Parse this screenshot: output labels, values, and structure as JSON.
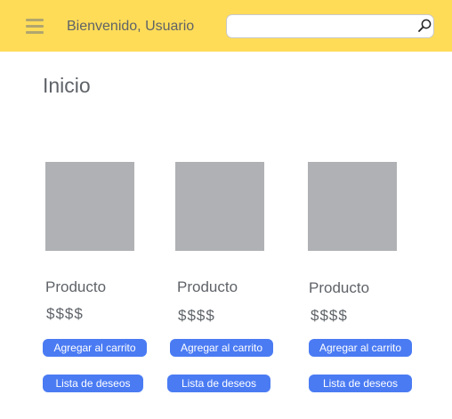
{
  "header": {
    "welcome_text": "Bienvenido, Usuario",
    "search": {
      "value": "",
      "placeholder": ""
    },
    "icons": {
      "menu": "hamburger-menu-icon",
      "search": "magnifier-icon"
    },
    "background_color": "#ffdc58"
  },
  "page": {
    "title": "Inicio"
  },
  "products": [
    {
      "name": "Producto",
      "price": "$$$$",
      "add_to_cart_label": "Agregar al carrito",
      "wishlist_label": "Lista de deseos"
    },
    {
      "name": "Producto",
      "price": "$$$$",
      "add_to_cart_label": "Agregar al carrito",
      "wishlist_label": "Lista de deseos"
    },
    {
      "name": "Producto",
      "price": "$$$$",
      "add_to_cart_label": "Agregar al carrito",
      "wishlist_label": "Lista de deseos"
    }
  ],
  "colors": {
    "accent_button": "#4a7bf3",
    "image_placeholder": "#b0b1b4",
    "text": "#5f6368"
  }
}
